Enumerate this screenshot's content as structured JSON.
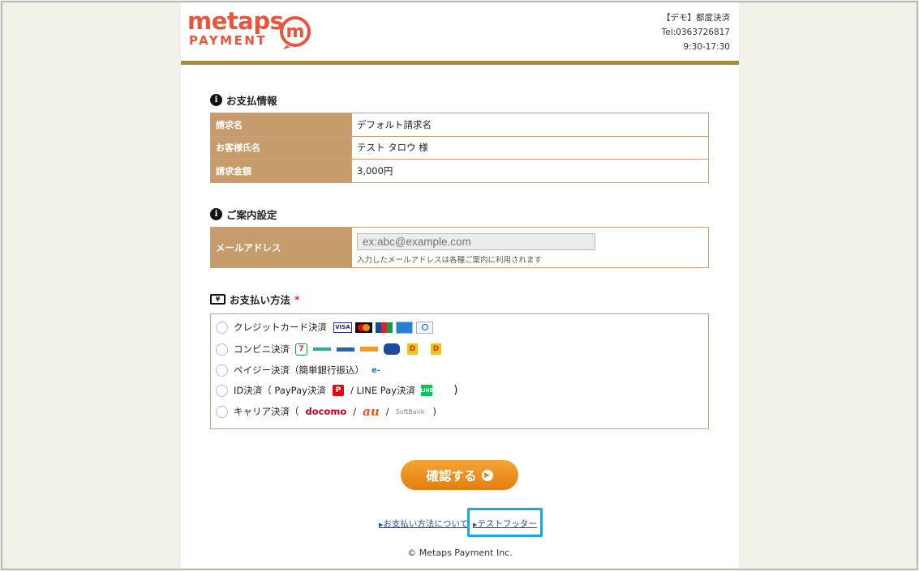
{
  "header": {
    "logo_text_top": "metaps",
    "logo_text_bottom": "PAYMENT",
    "logo_m": "m",
    "contact_line1": "【デモ】都度決済",
    "contact_line2": "Tel:0363726817",
    "contact_line3": "9:30-17:30",
    "accent_color": "#a78d2c",
    "brand_color": "#e8543c"
  },
  "payment_info": {
    "title": "お支払情報",
    "rows": [
      {
        "label": "請求名",
        "value": "デフォルト請求名"
      },
      {
        "label": "お客様氏名",
        "value": "テスト タロウ 様"
      },
      {
        "label": "請求金額",
        "value": "3,000円"
      }
    ]
  },
  "notice": {
    "title": "ご案内設定",
    "email_label": "メールアドレス",
    "email_placeholder": "ex:abc@example.com",
    "email_value": "",
    "email_note": "入力したメールアドレスは各種ご案内に利用されます"
  },
  "methods": {
    "title": "お支払い方法",
    "required_mark": "*",
    "items": [
      {
        "label": "クレジットカード決済",
        "extra": ""
      },
      {
        "label": "コンビニ決済",
        "extra": ""
      },
      {
        "label": "ペイジー決済（簡単銀行振込）",
        "extra": ""
      },
      {
        "label": "ID決済（ PayPay決済",
        "sep": "/ LINE Pay決済",
        "close": ")"
      },
      {
        "label": "キャリア決済（",
        "docomo": "docomo",
        "au": "au",
        "softbank": "SoftBank",
        "sep": "/",
        "close": ")"
      }
    ],
    "card_brands": [
      "VISA",
      "MasterCard",
      "JCB",
      "AMEX",
      "Diners"
    ],
    "cvs_brands": [
      "7-Eleven",
      "FamilyMart",
      "LAWSON",
      "MINISTOP",
      "Seicomart",
      "Daily Yamazaki",
      "Yamazaki"
    ]
  },
  "actions": {
    "confirm_label": "確認する"
  },
  "footer": {
    "link1": "お支払い方法について",
    "link2": "テストフッター",
    "copyright": "© Metaps Payment Inc."
  }
}
